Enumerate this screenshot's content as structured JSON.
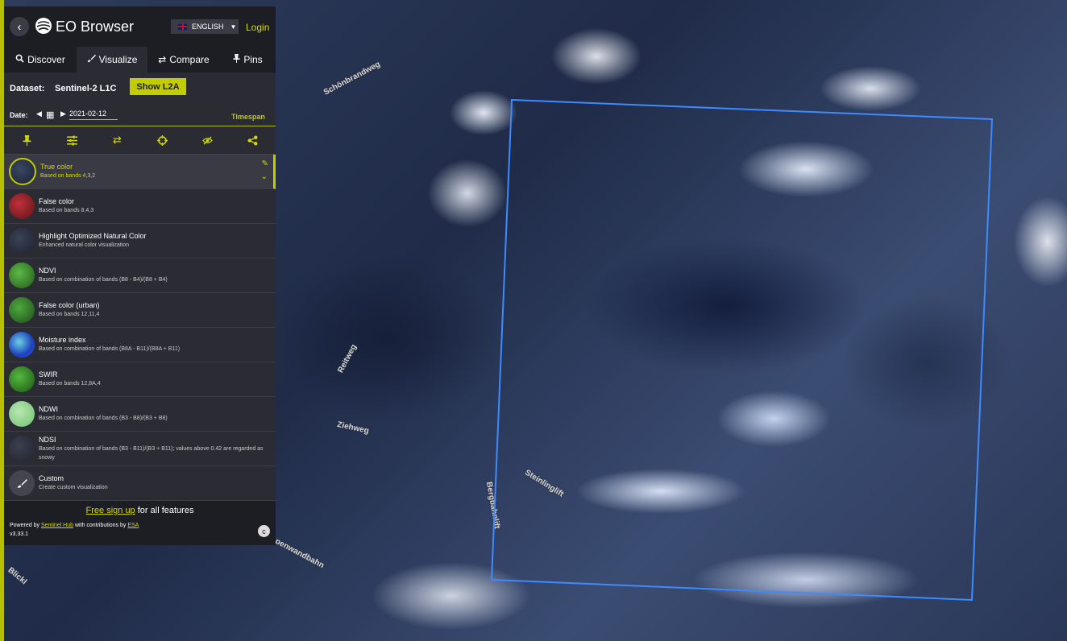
{
  "header": {
    "back_icon": "chevron-left-icon",
    "app_title": "EO Browser",
    "language": "ENGLISH",
    "login": "Login"
  },
  "tabs": [
    {
      "icon": "search-icon",
      "label": "Discover"
    },
    {
      "icon": "brush-icon",
      "label": "Visualize",
      "active": true
    },
    {
      "icon": "swap-icon",
      "label": "Compare"
    },
    {
      "icon": "pin-icon",
      "label": "Pins"
    }
  ],
  "dataset": {
    "label": "Dataset:",
    "value": "Sentinel-2 L1C",
    "show_l2a": "Show L2A"
  },
  "date": {
    "label": "Date:",
    "value": "2021-02-12",
    "timespan": "Timespan"
  },
  "toolbar_icons": [
    "pin-icon",
    "sliders-icon",
    "swap-icon",
    "crosshair-icon",
    "eye-slash-icon",
    "share-icon"
  ],
  "layers": [
    {
      "name": "True color",
      "desc": "Based on bands 4,3,2",
      "active": true
    },
    {
      "name": "False color",
      "desc": "Based on bands 8,4,3"
    },
    {
      "name": "Highlight Optimized Natural Color",
      "desc": "Enhanced natural color visualization"
    },
    {
      "name": "NDVI",
      "desc": "Based on combination of bands (B8 - B4)/(B8 + B4)"
    },
    {
      "name": "False color (urban)",
      "desc": "Based on bands 12,11,4"
    },
    {
      "name": "Moisture index",
      "desc": "Based on combination of bands (B8A - B11)/(B8A + B11)"
    },
    {
      "name": "SWIR",
      "desc": "Based on bands 12,8A,4"
    },
    {
      "name": "NDWI",
      "desc": "Based on combination of bands (B3 - B8)/(B3 + B8)"
    },
    {
      "name": "NDSI",
      "desc": "Based on combination of bands (B3 - B11)/(B3 + B11); values above 0.42 are regarded as snowy"
    },
    {
      "name": "Custom",
      "desc": "Create custom visualization"
    }
  ],
  "footer": {
    "signup_link": "Free sign up",
    "signup_rest": " for all features",
    "powered_prefix": "Powered by ",
    "powered_link1": "Sentinel Hub",
    "powered_mid": " with contributions by ",
    "powered_link2": "ESA",
    "version": "v3.33.1"
  },
  "map": {
    "roads": [
      "Schönbrandweg",
      "Reitweg",
      "Ziehweg",
      "Steinlinglift",
      "Bergbahnlift",
      "penwandbahn",
      "Blickl"
    ],
    "aoi_color": "#3d8bff"
  },
  "colors": {
    "accent": "#c3cc00",
    "panel_bg": "#2b2b33",
    "header_bg": "#1d1d24"
  }
}
